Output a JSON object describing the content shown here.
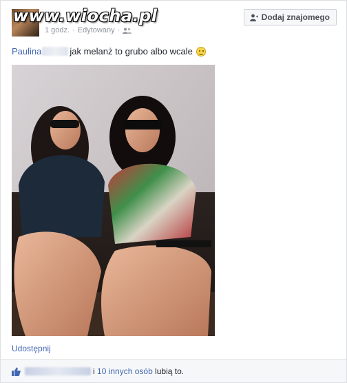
{
  "header": {
    "watermark": "www.wiocha.pl",
    "time": "1 godz.",
    "separator": "·",
    "edited": "Edytowany",
    "separator2": "·",
    "privacy_icon": "friends-icon",
    "add_friend_label": "Dodaj znajomego",
    "add_friend_icon": "add-friend-icon"
  },
  "post": {
    "author_first": "Paulina",
    "message": "jak melanż to grubo albo wcale",
    "emoji": "smiley-icon"
  },
  "photo": {
    "description_icon": "photo"
  },
  "actions": {
    "share_label": "Udostępnij"
  },
  "likes": {
    "icon": "thumbs-up-icon",
    "connector": "i",
    "others_link": "10 innych osób",
    "suffix": "lubią to."
  },
  "colors": {
    "link": "#4267b2",
    "meta": "#90949c",
    "card_bg": "#ffffff",
    "likes_bg": "#f6f7f9"
  }
}
